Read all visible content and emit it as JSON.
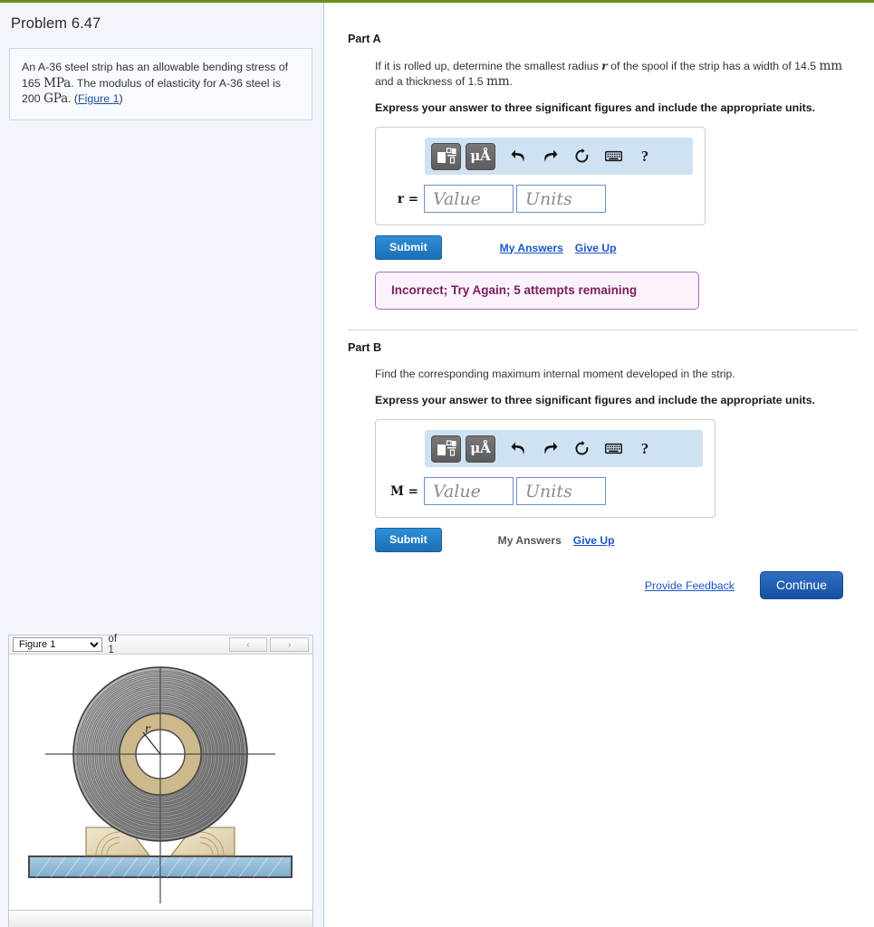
{
  "problem": {
    "title": "Problem 6.47",
    "statement_pre": "An A-36 steel strip has an allowable bending stress of 165 ",
    "unit_mpa": "MPa",
    "statement_mid": ". The modulus of elasticity for A-36 steel is 200 ",
    "unit_gpa": "GPa",
    "statement_post": ". (",
    "figure_link": "Figure 1",
    "statement_end": ")"
  },
  "figure_panel": {
    "selected": "Figure 1",
    "options": [
      "Figure 1"
    ],
    "count_label": "of 1",
    "prev_icon": "chevron-left-icon",
    "next_icon": "chevron-right-icon",
    "radius_label": "r"
  },
  "parts": [
    {
      "heading": "Part A",
      "question_pre": "If it is rolled up, determine the smallest radius ",
      "question_var": "r",
      "question_post_a": " of the spool if the strip has a width of 14.5 ",
      "unit_1": "mm",
      "question_post_b": " and a thickness of 1.5 ",
      "unit_2": "mm",
      "question_end": ".",
      "instruction": "Express your answer to three significant figures and include the appropriate units.",
      "input_label": "r =",
      "value_placeholder": "Value",
      "units_placeholder": "Units",
      "submit_label": "Submit",
      "my_answers_label": "My Answers",
      "my_answers_state": "link",
      "give_up_label": "Give Up",
      "feedback": "Incorrect; Try Again; 5 attempts remaining"
    },
    {
      "heading": "Part B",
      "question": "Find the corresponding maximum internal moment developed in the strip.",
      "instruction": "Express your answer to three significant figures and include the appropriate units.",
      "input_label": "M =",
      "value_placeholder": "Value",
      "units_placeholder": "Units",
      "submit_label": "Submit",
      "my_answers_label": "My Answers",
      "my_answers_state": "disabled",
      "give_up_label": "Give Up"
    }
  ],
  "toolbar": {
    "template_icon": "math-template-icon",
    "units_icon": "micro-angstrom-icon",
    "units_label": "μÅ",
    "undo_icon": "undo-icon",
    "redo_icon": "redo-icon",
    "reset_icon": "reset-icon",
    "keyboard_icon": "keyboard-icon",
    "help_icon": "help-icon",
    "help_label": "?"
  },
  "footer": {
    "provide_feedback_label": "Provide Feedback",
    "continue_label": "Continue"
  },
  "colors": {
    "accent_blue": "#1b6fb5",
    "link_blue": "#1a55cc",
    "toolbar_blue": "#cfe2f3",
    "feedback_bg": "#fbf2fb",
    "feedback_border": "#a66bbf",
    "feedback_text": "#7a2060",
    "top_rule_green": "#6b8e1a",
    "panel_bg": "#f2f6fc"
  }
}
